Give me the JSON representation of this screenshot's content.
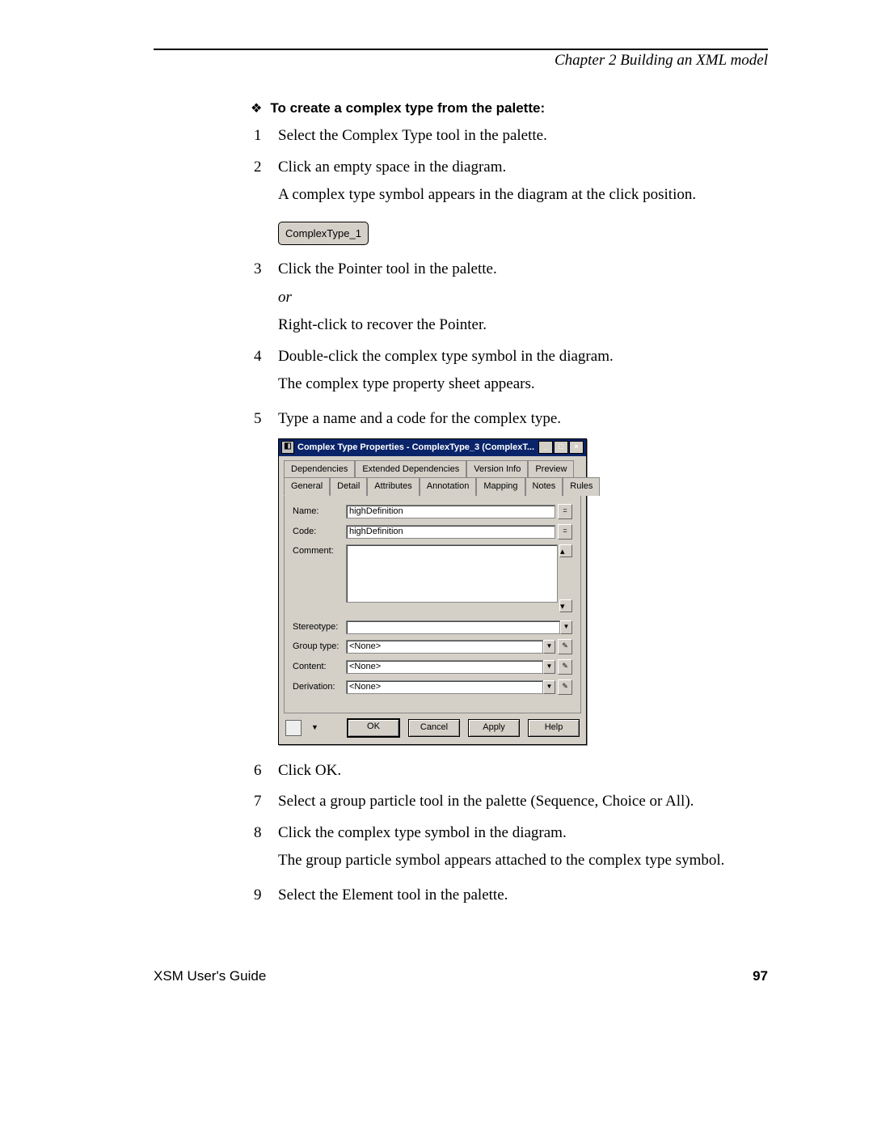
{
  "chapter": "Chapter 2  Building an XML model",
  "heading": "To create a complex type from the palette:",
  "steps": {
    "s1": {
      "n": "1",
      "text": "Select the Complex Type tool in the palette."
    },
    "s2": {
      "n": "2",
      "text": "Click an empty space in the diagram.",
      "follow": "A complex type symbol appears in the diagram at the click position."
    },
    "box_label": "ComplexType_1",
    "s3": {
      "n": "3",
      "text": "Click the Pointer tool in the palette.",
      "or": "or",
      "follow": "Right-click to recover the Pointer."
    },
    "s4": {
      "n": "4",
      "text": "Double-click the complex type symbol in the diagram.",
      "follow": "The complex type property sheet appears."
    },
    "s5": {
      "n": "5",
      "text": "Type a name and a code for the complex type."
    },
    "s6": {
      "n": "6",
      "text": "Click OK."
    },
    "s7": {
      "n": "7",
      "text": "Select a group particle tool in the palette (Sequence, Choice or All)."
    },
    "s8": {
      "n": "8",
      "text": "Click the complex type symbol in the diagram.",
      "follow": "The group particle symbol appears attached to the complex type symbol."
    },
    "s9": {
      "n": "9",
      "text": "Select the Element tool in the palette."
    }
  },
  "dialog": {
    "title": "Complex Type Properties - ComplexType_3 (ComplexT...",
    "tabs_row1": [
      "Dependencies",
      "Extended Dependencies",
      "Version Info",
      "Preview"
    ],
    "tabs_row2": [
      "General",
      "Detail",
      "Attributes",
      "Annotation",
      "Mapping",
      "Notes",
      "Rules"
    ],
    "labels": {
      "name": "Name:",
      "code": "Code:",
      "comment": "Comment:",
      "stereotype": "Stereotype:",
      "group": "Group type:",
      "content": "Content:",
      "derivation": "Derivation:"
    },
    "values": {
      "name": "highDefinition",
      "code": "highDefinition",
      "group": "<None>",
      "content": "<None>",
      "derivation": "<None>"
    },
    "buttons": {
      "ok": "OK",
      "cancel": "Cancel",
      "apply": "Apply",
      "help": "Help"
    },
    "win": {
      "min": "_",
      "max": "□",
      "close": "×"
    }
  },
  "footer": {
    "guide": "XSM User's Guide",
    "page": "97"
  }
}
